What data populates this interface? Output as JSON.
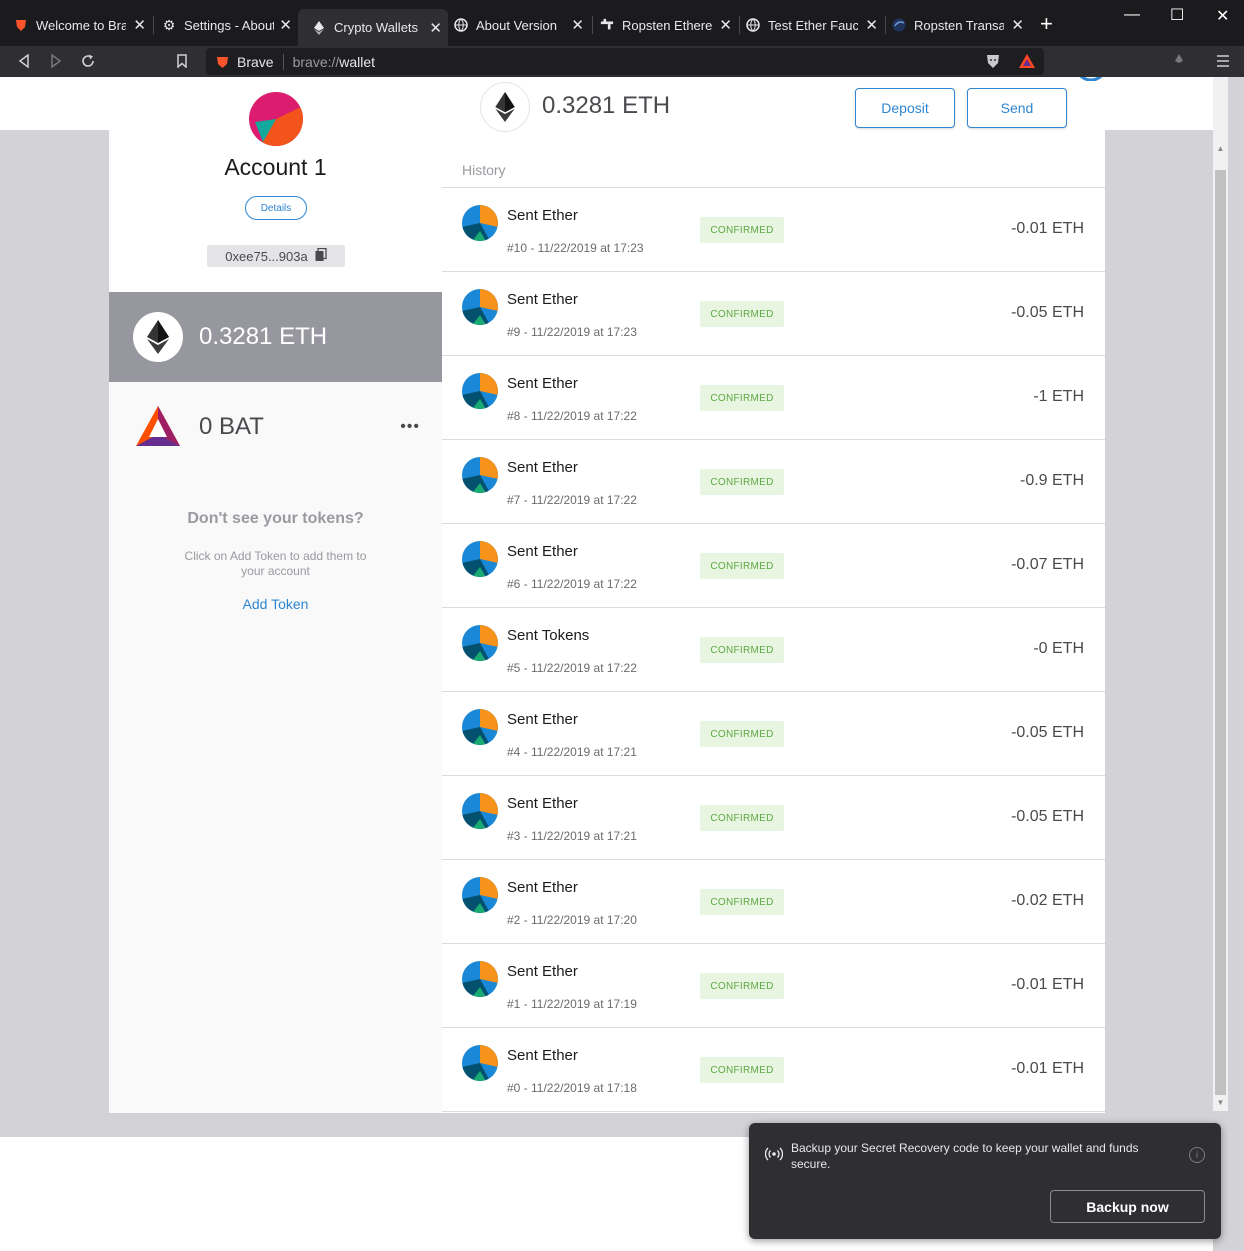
{
  "tabs": [
    {
      "title": "Welcome to Brave",
      "icon": "brave-lion-icon"
    },
    {
      "title": "Settings - About",
      "icon": "gear-icon"
    },
    {
      "title": "Crypto Wallets",
      "icon": "ethereum-icon"
    },
    {
      "title": "About Version",
      "icon": "globe-icon"
    },
    {
      "title": "Ropsten Ethereum",
      "icon": "faucet-icon"
    },
    {
      "title": "Test Ether Faucet",
      "icon": "globe-icon"
    },
    {
      "title": "Ropsten Transactions",
      "icon": "etherscan-icon"
    }
  ],
  "toolbar": {
    "brave_label": "Brave",
    "url_scheme": "brave://",
    "url_path": "wallet"
  },
  "account": {
    "name": "Account 1",
    "details_label": "Details",
    "address": "0xee75...903a"
  },
  "tokens": [
    {
      "balance": "0.3281 ETH",
      "icon": "ethereum-icon"
    },
    {
      "balance": "0 BAT",
      "icon": "bat-icon"
    }
  ],
  "no_tokens": {
    "title": "Don't see your tokens?",
    "description": "Click on Add Token to add them to your account",
    "add_label": "Add Token"
  },
  "header": {
    "balance": "0.3281 ETH",
    "deposit_label": "Deposit",
    "send_label": "Send"
  },
  "history": {
    "label": "History",
    "transactions": [
      {
        "title": "Sent Ether",
        "meta": "#10 - 11/22/2019 at 17:23",
        "status": "CONFIRMED",
        "amount": "-0.01 ETH"
      },
      {
        "title": "Sent Ether",
        "meta": "#9 - 11/22/2019 at 17:23",
        "status": "CONFIRMED",
        "amount": "-0.05 ETH"
      },
      {
        "title": "Sent Ether",
        "meta": "#8 - 11/22/2019 at 17:22",
        "status": "CONFIRMED",
        "amount": "-1 ETH"
      },
      {
        "title": "Sent Ether",
        "meta": "#7 - 11/22/2019 at 17:22",
        "status": "CONFIRMED",
        "amount": "-0.9 ETH"
      },
      {
        "title": "Sent Ether",
        "meta": "#6 - 11/22/2019 at 17:22",
        "status": "CONFIRMED",
        "amount": "-0.07 ETH"
      },
      {
        "title": "Sent Tokens",
        "meta": "#5 - 11/22/2019 at 17:22",
        "status": "CONFIRMED",
        "amount": "-0 ETH"
      },
      {
        "title": "Sent Ether",
        "meta": "#4 - 11/22/2019 at 17:21",
        "status": "CONFIRMED",
        "amount": "-0.05 ETH"
      },
      {
        "title": "Sent Ether",
        "meta": "#3 - 11/22/2019 at 17:21",
        "status": "CONFIRMED",
        "amount": "-0.05 ETH"
      },
      {
        "title": "Sent Ether",
        "meta": "#2 - 11/22/2019 at 17:20",
        "status": "CONFIRMED",
        "amount": "-0.02 ETH"
      },
      {
        "title": "Sent Ether",
        "meta": "#1 - 11/22/2019 at 17:19",
        "status": "CONFIRMED",
        "amount": "-0.01 ETH"
      },
      {
        "title": "Sent Ether",
        "meta": "#0 - 11/22/2019 at 17:18",
        "status": "CONFIRMED",
        "amount": "-0.01 ETH"
      }
    ]
  },
  "toast": {
    "message": "Backup your Secret Recovery code to keep your wallet and funds secure.",
    "button_label": "Backup now"
  },
  "colors": {
    "accent": "#2f86d1",
    "confirmed_bg": "#e8f5e1",
    "confirmed_text": "#5fa844",
    "selected_token_bg": "#97979f"
  }
}
